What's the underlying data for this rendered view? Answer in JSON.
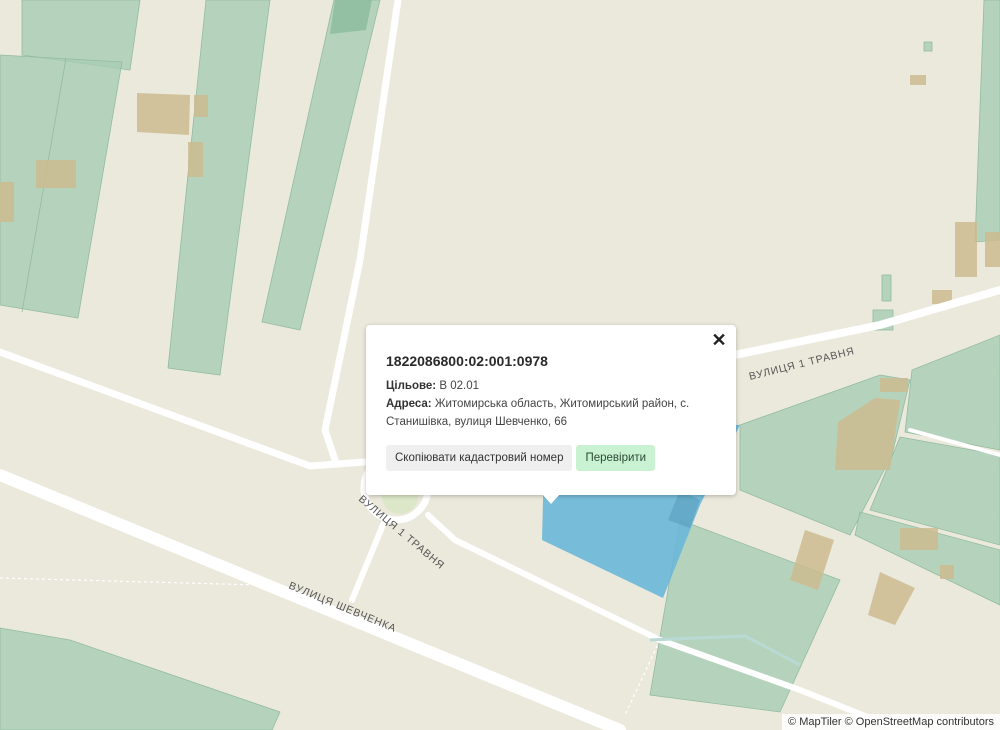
{
  "map": {
    "streets": [
      {
        "id": "shevchenka",
        "label": "ВУЛИЦЯ ШЕВЧЕНКА"
      },
      {
        "id": "1-travnia-east",
        "label": "ВУЛИЦЯ 1 ТРАВНЯ"
      },
      {
        "id": "1-travnia-ring",
        "label": "ВУЛИЦЯ 1 ТРАВНЯ"
      }
    ],
    "colors": {
      "background": "#ebe9dc",
      "parcel_green": "#a8cdb4",
      "building_tan": "#cdbb91",
      "road": "#ffffff",
      "selected_parcel": "#6ab7d8"
    }
  },
  "popup": {
    "parcel_id": "1822086800:02:001:0978",
    "purpose_label": "Цільове:",
    "purpose_value": "В 02.01",
    "address_label": "Адреса:",
    "address_value": "Житомирська область, Житомирський район, с. Станишівка, вулиця Шевченко, 66",
    "copy_button": "Скопіювати кадастровий номер",
    "check_button": "Перевірити",
    "close_icon": "close-icon"
  },
  "attribution": "© MapTiler © OpenStreetMap contributors"
}
